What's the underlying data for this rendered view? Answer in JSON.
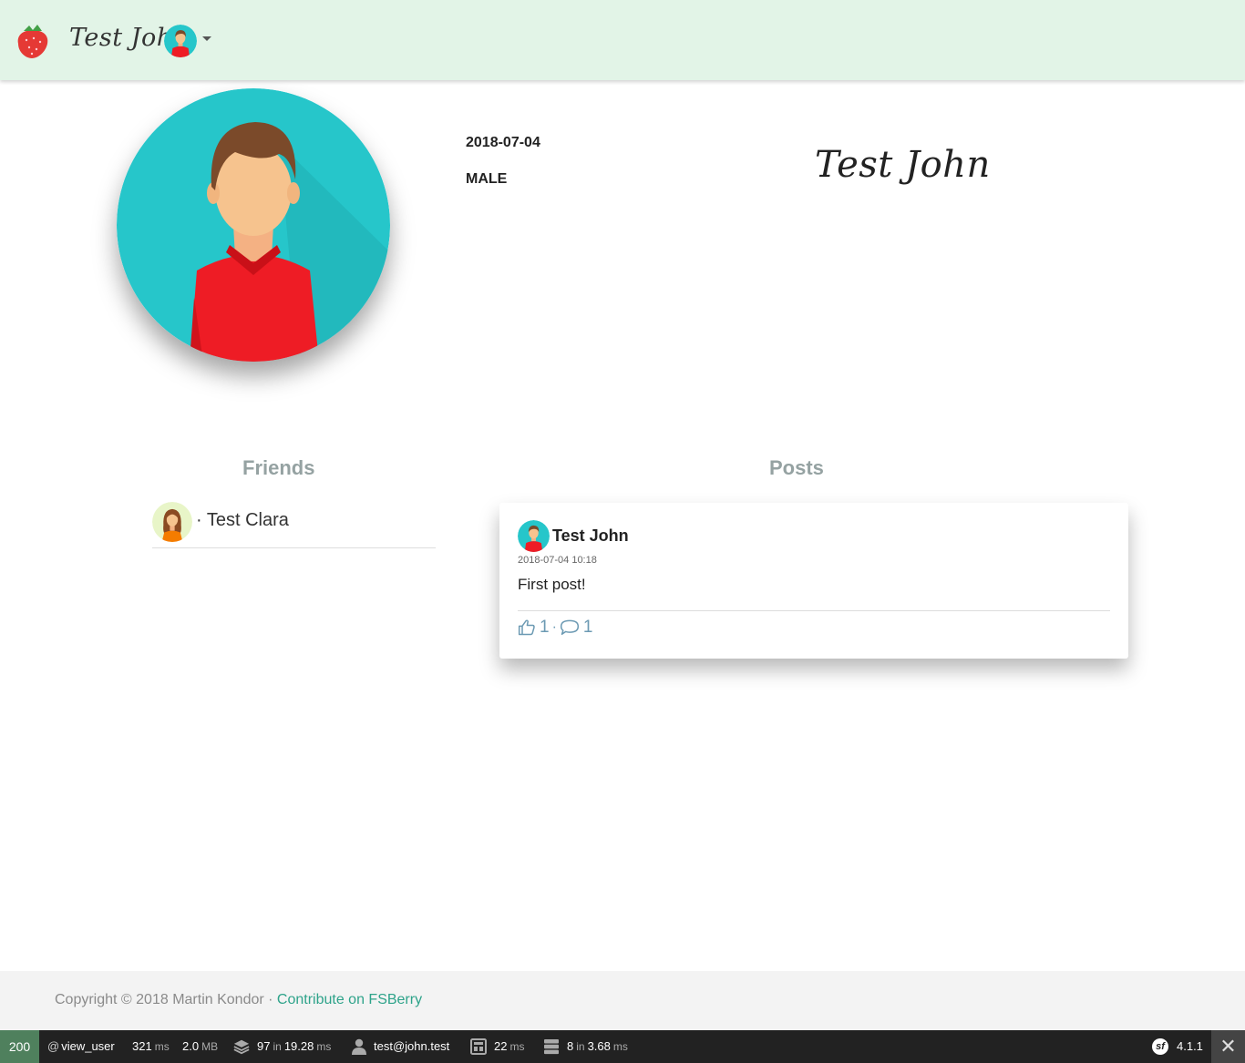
{
  "navbar": {
    "logo_icon": "strawberry-icon",
    "user_name": "Test John",
    "user_avatar_icon": "male-avatar-icon",
    "caret_icon": "caret-down-icon"
  },
  "profile": {
    "avatar_icon": "male-avatar-icon",
    "birthdate": "2018-07-04",
    "gender": "MALE",
    "name": "Test John"
  },
  "friends": {
    "title": "Friends",
    "items": [
      {
        "avatar_icon": "female-avatar-icon",
        "name": "· Test Clara"
      }
    ]
  },
  "posts": {
    "title": "Posts",
    "items": [
      {
        "avatar_icon": "male-avatar-icon",
        "author": "Test John",
        "date": "2018-07-04 10:18",
        "text": "First post!",
        "likes": "1",
        "separator": "·",
        "comments": "1"
      }
    ]
  },
  "footer": {
    "copyright": "Copyright © 2018 Martin Kondor · ",
    "link": "Contribute on FSBerry"
  },
  "toolbar": {
    "status": "200",
    "route_prefix": "@",
    "route": "view_user",
    "time": "321",
    "time_unit": "ms",
    "memory": "2.0",
    "memory_unit": "MB",
    "forms": "97",
    "forms_in": "in",
    "forms_time": "19.28",
    "forms_unit": "ms",
    "user": "test@john.test",
    "twig_time": "22",
    "twig_unit": "ms",
    "db_queries": "8",
    "db_in": "in",
    "db_time": "3.68",
    "db_unit": "ms",
    "symfony_logo": "sf",
    "version": "4.1.1",
    "close_icon": "close-icon",
    "close_glyph": "✕"
  },
  "colors": {
    "navbar_bg": "#e2f4e7",
    "avatar_bg": "#26c6ca",
    "shirt_red": "#ee1c25",
    "section_title": "#95a2a2",
    "link": "#2ea38a",
    "action_blue": "#6c9ab3",
    "toolbar_status": "#4f805d"
  }
}
